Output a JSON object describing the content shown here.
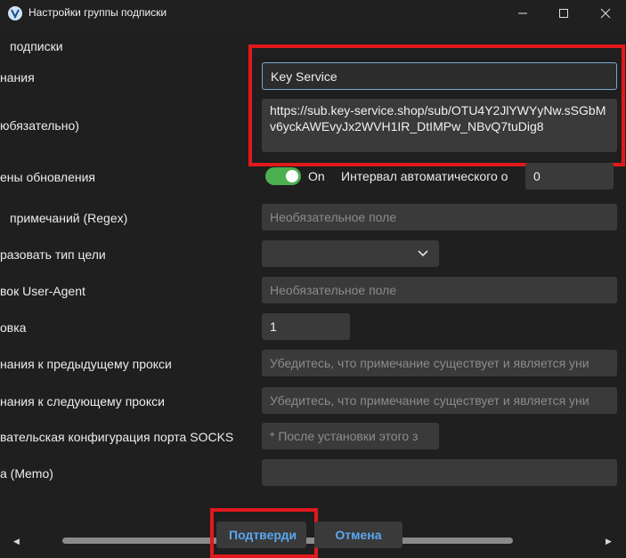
{
  "window": {
    "title": "Настройки группы подписки",
    "icons": {
      "app": "v-logo-icon",
      "minimize": "minimize-icon",
      "maximize": "maximize-icon",
      "close": "close-icon"
    }
  },
  "labels": {
    "group": "подписки",
    "name": "нания",
    "url": "юбязательно)",
    "update_time": "ены обновления",
    "filter": "примечаний (Regex)",
    "convert_target": "разовать тип цели",
    "user_agent": "вок User-Agent",
    "sort": "овка",
    "prev_proxy": "нания к предыдущему прокси",
    "next_proxy": "нания к следующему прокси",
    "socks": "вательская конфигурация порта SOCKS",
    "memo": "а (Memo)"
  },
  "fields": {
    "name_value": "Key Service",
    "url_value": "https://sub.key-service.shop/sub/OTU4Y2JlYWYyNw.sSGbMv6yckAWEvyJx2WVH1IR_DtIMPw_NBvQ7tuDig8",
    "auto_update_toggle": "On",
    "auto_update_label": "Интервал автоматического о",
    "interval_value": "0",
    "filter_placeholder": "Необязательное поле",
    "user_agent_placeholder": "Необязательное поле",
    "sort_value": "1",
    "prev_proxy_placeholder": "Убедитесь, что примечание существует и является уни",
    "next_proxy_placeholder": "Убедитесь, что примечание существует и является уни",
    "socks_placeholder": "* После установки этого з"
  },
  "buttons": {
    "confirm": "Подтверди",
    "cancel": "Отмена"
  },
  "colors": {
    "accent": "#5aa8f0",
    "highlight": "#e0191b",
    "toggle_on": "#4caf50"
  }
}
